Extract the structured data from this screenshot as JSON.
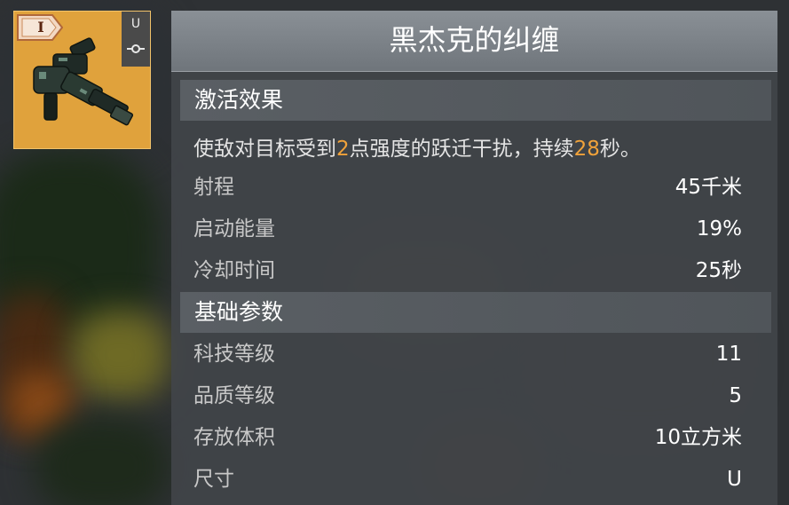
{
  "item": {
    "tier": "I",
    "size": "U",
    "icon": "turret-icon",
    "socket_icon": "socket-icon",
    "card_color": "#e0a23c"
  },
  "title": "黑杰克的纠缠",
  "sections": {
    "activation": {
      "header": "激活效果",
      "description": {
        "part1": "使敌对目标受到",
        "value1": "2",
        "part2": "点强度的跃迁干扰，持续",
        "value2": "28",
        "part3": "秒。"
      },
      "stats": [
        {
          "label": "射程",
          "value": "45千米"
        },
        {
          "label": "启动能量",
          "value": "19%"
        },
        {
          "label": "冷却时间",
          "value": "25秒"
        }
      ]
    },
    "basic": {
      "header": "基础参数",
      "stats": [
        {
          "label": "科技等级",
          "value": "11"
        },
        {
          "label": "品质等级",
          "value": "5"
        },
        {
          "label": "存放体积",
          "value": "10立方米"
        },
        {
          "label": "尺寸",
          "value": "U"
        }
      ]
    }
  },
  "colors": {
    "highlight": "#f0a23a",
    "panel": "#42464a",
    "title_bar": "#7c8288"
  }
}
